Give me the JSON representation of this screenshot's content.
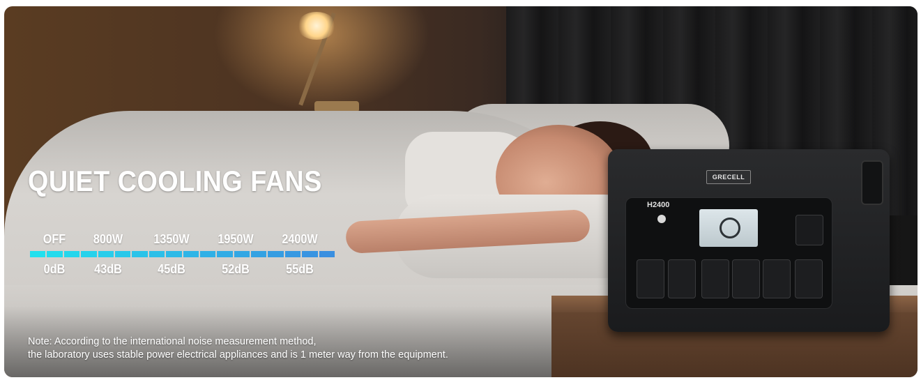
{
  "headline": "QUIET COOLING FANS",
  "power_levels": [
    "OFF",
    "800W",
    "1350W",
    "1950W",
    "2400W"
  ],
  "noise_levels": [
    "0dB",
    "43dB",
    "45dB",
    "52dB",
    "55dB"
  ],
  "bar_colors": {
    "start": "#22e0ee",
    "end": "#3a8fe0"
  },
  "note_line_1": "Note: According to the international noise measurement method,",
  "note_line_2": "the laboratory uses stable power electrical appliances and is 1 meter way from the equipment.",
  "product": {
    "brand": "GRECELL",
    "model": "H2400"
  }
}
